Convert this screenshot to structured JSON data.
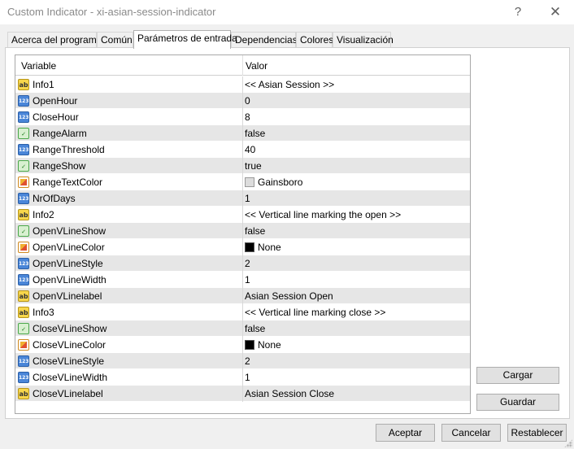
{
  "window": {
    "title": "Custom Indicator - xi-asian-session-indicator",
    "help_label": "?",
    "close_label": "✕"
  },
  "tabs": [
    {
      "label": "Acerca del programa"
    },
    {
      "label": "Común"
    },
    {
      "label": "Parámetros de entrada",
      "active": true
    },
    {
      "label": "Dependencias"
    },
    {
      "label": "Colores"
    },
    {
      "label": "Visualización"
    }
  ],
  "grid": {
    "header_variable": "Variable",
    "header_value": "Valor",
    "rows": [
      {
        "icon": "string-type-icon",
        "name": "Info1",
        "value": "<< Asian Session >>"
      },
      {
        "icon": "integer-type-icon",
        "name": "OpenHour",
        "value": "0"
      },
      {
        "icon": "integer-type-icon",
        "name": "CloseHour",
        "value": "8"
      },
      {
        "icon": "boolean-type-icon",
        "name": "RangeAlarm",
        "value": "false"
      },
      {
        "icon": "integer-type-icon",
        "name": "RangeThreshold",
        "value": "40"
      },
      {
        "icon": "boolean-type-icon",
        "name": "RangeShow",
        "value": "true"
      },
      {
        "icon": "color-type-icon",
        "name": "RangeTextColor",
        "value": "Gainsboro",
        "swatch": "#dcdcdc"
      },
      {
        "icon": "integer-type-icon",
        "name": "NrOfDays",
        "value": "1"
      },
      {
        "icon": "string-type-icon",
        "name": "Info2",
        "value": "<< Vertical line marking the open >>"
      },
      {
        "icon": "boolean-type-icon",
        "name": "OpenVLineShow",
        "value": "false"
      },
      {
        "icon": "color-type-icon",
        "name": "OpenVLineColor",
        "value": "None",
        "swatch": "#000000"
      },
      {
        "icon": "integer-type-icon",
        "name": "OpenVLineStyle",
        "value": "2"
      },
      {
        "icon": "integer-type-icon",
        "name": "OpenVLineWidth",
        "value": "1"
      },
      {
        "icon": "string-type-icon",
        "name": "OpenVLinelabel",
        "value": "Asian Session Open"
      },
      {
        "icon": "string-type-icon",
        "name": "Info3",
        "value": "<< Vertical line marking close >>"
      },
      {
        "icon": "boolean-type-icon",
        "name": "CloseVLineShow",
        "value": "false"
      },
      {
        "icon": "color-type-icon",
        "name": "CloseVLineColor",
        "value": "None",
        "swatch": "#000000"
      },
      {
        "icon": "integer-type-icon",
        "name": "CloseVLineStyle",
        "value": "2"
      },
      {
        "icon": "integer-type-icon",
        "name": "CloseVLineWidth",
        "value": "1"
      },
      {
        "icon": "string-type-icon",
        "name": "CloseVLinelabel",
        "value": "Asian Session Close"
      }
    ]
  },
  "side_buttons": {
    "load": "Cargar",
    "save": "Guardar"
  },
  "footer_buttons": {
    "ok": "Aceptar",
    "cancel": "Cancelar",
    "reset": "Restablecer"
  },
  "icon_glyphs": {
    "string-type-icon": "ab",
    "integer-type-icon": "123",
    "boolean-type-icon": "✓",
    "color-type-icon": ""
  }
}
